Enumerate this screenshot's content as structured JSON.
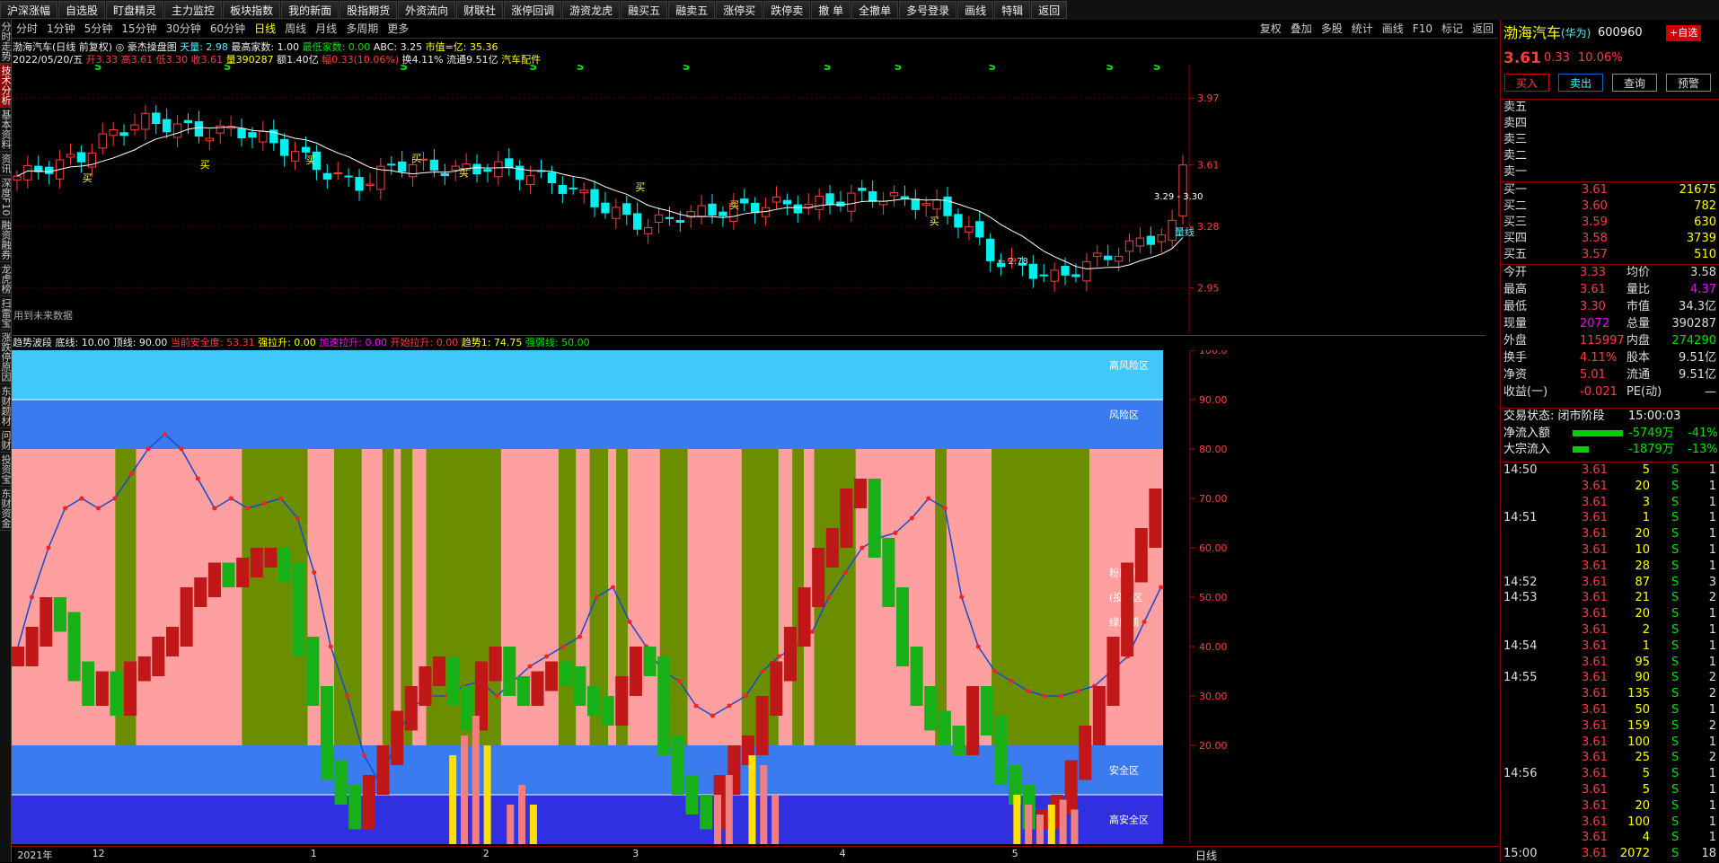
{
  "toolbar": [
    "沪深涨幅",
    "自选股",
    "盯盘精灵",
    "主力监控",
    "板块指数",
    "我的新面",
    "股指期货",
    "外资流向",
    "财联社",
    "涨停回调",
    "游资龙虎",
    "融买五",
    "融卖五",
    "涨停买",
    "跌停卖",
    "撤 单",
    "全撤单",
    "多号登录",
    "画线",
    "特辑",
    "返回"
  ],
  "left_tabs": [
    "分时走势",
    "技术分析",
    "基本资料",
    "资讯",
    "深度F10",
    "融资融券",
    "龙虎榜",
    "扫雷宝",
    "涨跌停原因",
    "东财题材",
    "问财",
    "投资宝",
    "东财资金"
  ],
  "periods": [
    "分时",
    "1分钟",
    "5分钟",
    "15分钟",
    "30分钟",
    "60分钟",
    "日线",
    "周线",
    "月线",
    "多周期",
    "更多"
  ],
  "period_active": "日线",
  "right_tools": [
    "复权",
    "叠加",
    "多股",
    "统计",
    "画线",
    "F10",
    "标记",
    "返回"
  ],
  "info1": {
    "stock": "渤海汽车(日线 前复权)",
    "indicator": "◎ 豪杰操盘图",
    "tl_label": "天量: 2.98",
    "zx_label": "最高家数: 1.00",
    "zd_label": "最低家数: 0.00",
    "abc": "ABC: 3.25",
    "market": "市值=亿: 35.36"
  },
  "info2": {
    "date": "2022/05/20/五",
    "open": "开3.33",
    "high": "高3.61",
    "low": "低3.30",
    "close": "收3.61",
    "vol": "量390287",
    "amt": "额1.40亿",
    "chg": "幅0.33(10.06%)",
    "turnover": "换4.11%",
    "float": "流通9.51亿",
    "sector": "汽车配件"
  },
  "upper_note": "用到未来数据",
  "upper_axis": [
    "3.97",
    "3.61",
    "3.28",
    "2.95"
  ],
  "upper_labels": {
    "range": "3.29 - 3.30",
    "low_mark": "2.78",
    "ma_label": "量线"
  },
  "sub_info": {
    "name": "趋势波段",
    "base": "底线: 10.00",
    "top": "顶线: 90.00",
    "safety": "当前安全度: 53.31",
    "strong": "强拉升: 0.00",
    "accel": "加速拉升: 0.00",
    "start": "开始拉升: 0.00",
    "trend": "趋势1: 74.75",
    "weak": "强弱线: 50.00"
  },
  "zone_labels": [
    "高风险区",
    "风险区",
    "粉区预",
    "(投资区",
    "绿区预",
    "安全区",
    "高安全区"
  ],
  "lower_axis": [
    "100.0",
    "90.00",
    "80.00",
    "70.00",
    "60.00",
    "50.00",
    "40.00",
    "30.00",
    "20.00"
  ],
  "time_axis": [
    "2021年",
    "12",
    "1",
    "2",
    "3",
    "4",
    "5"
  ],
  "period_footer": "日线",
  "quote": {
    "name": "渤海汽车",
    "tag": "(华为)",
    "code": "600960",
    "add_label": "+自选",
    "price": "3.61",
    "chg": "0.33",
    "pct": "10.06%",
    "buy_label": "买入",
    "sell_label": "卖出",
    "query_label": "查询",
    "warn_label": "预警",
    "asks": [
      {
        "label": "卖五",
        "price": "",
        "vol": ""
      },
      {
        "label": "卖四",
        "price": "",
        "vol": ""
      },
      {
        "label": "卖三",
        "price": "",
        "vol": ""
      },
      {
        "label": "卖二",
        "price": "",
        "vol": ""
      },
      {
        "label": "卖一",
        "price": "",
        "vol": ""
      }
    ],
    "bids": [
      {
        "label": "买一",
        "price": "3.61",
        "vol": "21675"
      },
      {
        "label": "买二",
        "price": "3.60",
        "vol": "782"
      },
      {
        "label": "买三",
        "price": "3.59",
        "vol": "630"
      },
      {
        "label": "买四",
        "price": "3.58",
        "vol": "3739"
      },
      {
        "label": "买五",
        "price": "3.57",
        "vol": "510"
      }
    ],
    "stats": [
      {
        "l1": "今开",
        "v1": "3.33",
        "l2": "均价",
        "v2": "3.58"
      },
      {
        "l1": "最高",
        "v1": "3.61",
        "l2": "量比",
        "v2": "4.37"
      },
      {
        "l1": "最低",
        "v1": "3.30",
        "l2": "市值",
        "v2": "34.3亿"
      },
      {
        "l1": "现量",
        "v1": "2072",
        "l2": "总量",
        "v2": "390287"
      },
      {
        "l1": "外盘",
        "v1": "115997",
        "l2": "内盘",
        "v2": "274290"
      },
      {
        "l1": "换手",
        "v1": "4.11%",
        "l2": "股本",
        "v2": "9.51亿"
      },
      {
        "l1": "净资",
        "v1": "5.01",
        "l2": "流通",
        "v2": "9.51亿"
      },
      {
        "l1": "收益(一)",
        "v1": "-0.021",
        "l2": "PE(动)",
        "v2": "—"
      }
    ],
    "status_label": "交易状态: 闭市阶段",
    "status_time": "15:00:03",
    "netflow_label": "净流入额",
    "netflow_val": "-5749万",
    "netflow_pct": "-41%",
    "bigflow_label": "大宗流入",
    "bigflow_val": "-1879万",
    "bigflow_pct": "-13%"
  },
  "ticks": [
    {
      "t": "14:50",
      "p": "3.61",
      "v": "5",
      "s": "S",
      "n": "1"
    },
    {
      "t": "",
      "p": "3.61",
      "v": "20",
      "s": "S",
      "n": "1"
    },
    {
      "t": "",
      "p": "3.61",
      "v": "3",
      "s": "S",
      "n": "1"
    },
    {
      "t": "14:51",
      "p": "3.61",
      "v": "1",
      "s": "S",
      "n": "1"
    },
    {
      "t": "",
      "p": "3.61",
      "v": "20",
      "s": "S",
      "n": "1"
    },
    {
      "t": "",
      "p": "3.61",
      "v": "10",
      "s": "S",
      "n": "1"
    },
    {
      "t": "",
      "p": "3.61",
      "v": "28",
      "s": "S",
      "n": "1"
    },
    {
      "t": "14:52",
      "p": "3.61",
      "v": "87",
      "s": "S",
      "n": "3"
    },
    {
      "t": "14:53",
      "p": "3.61",
      "v": "21",
      "s": "S",
      "n": "2"
    },
    {
      "t": "",
      "p": "3.61",
      "v": "20",
      "s": "S",
      "n": "1"
    },
    {
      "t": "",
      "p": "3.61",
      "v": "2",
      "s": "S",
      "n": "1"
    },
    {
      "t": "14:54",
      "p": "3.61",
      "v": "1",
      "s": "S",
      "n": "1"
    },
    {
      "t": "",
      "p": "3.61",
      "v": "95",
      "s": "S",
      "n": "1"
    },
    {
      "t": "14:55",
      "p": "3.61",
      "v": "90",
      "s": "S",
      "n": "2"
    },
    {
      "t": "",
      "p": "3.61",
      "v": "135",
      "s": "S",
      "n": "2"
    },
    {
      "t": "",
      "p": "3.61",
      "v": "50",
      "s": "S",
      "n": "1"
    },
    {
      "t": "",
      "p": "3.61",
      "v": "159",
      "s": "S",
      "n": "2"
    },
    {
      "t": "",
      "p": "3.61",
      "v": "100",
      "s": "S",
      "n": "1"
    },
    {
      "t": "",
      "p": "3.61",
      "v": "25",
      "s": "S",
      "n": "2"
    },
    {
      "t": "14:56",
      "p": "3.61",
      "v": "5",
      "s": "S",
      "n": "1"
    },
    {
      "t": "",
      "p": "3.61",
      "v": "5",
      "s": "S",
      "n": "1"
    },
    {
      "t": "",
      "p": "3.61",
      "v": "20",
      "s": "S",
      "n": "1"
    },
    {
      "t": "",
      "p": "3.61",
      "v": "100",
      "s": "S",
      "n": "1"
    },
    {
      "t": "",
      "p": "3.61",
      "v": "4",
      "s": "S",
      "n": "1"
    },
    {
      "t": "15:00",
      "p": "3.61",
      "v": "2072",
      "s": "S",
      "n": "18"
    }
  ],
  "colors": {
    "up": "#ff3c3c",
    "down": "#00e000",
    "pink": "#ffa0a0",
    "olive": "#6b8e00",
    "sky": "#40c8f8",
    "blue": "#3a7cf0",
    "navy": "#3030e0"
  }
}
